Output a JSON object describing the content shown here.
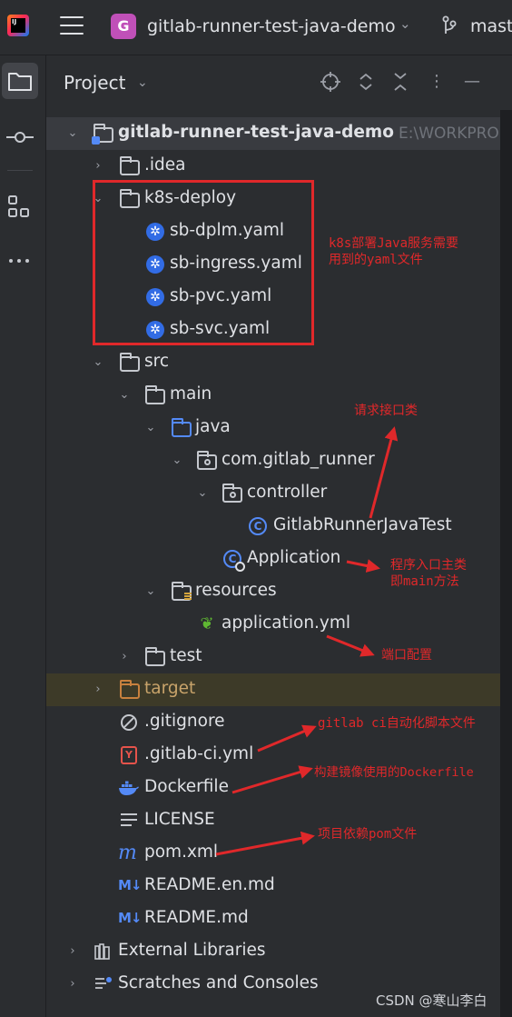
{
  "header": {
    "app_logo_text": "IJ",
    "project_badge": "G",
    "project_name": "gitlab-runner-test-java-demo",
    "branch_name": "mast"
  },
  "panel": {
    "title": "Project"
  },
  "tree": {
    "root": {
      "name": "gitlab-runner-test-java-demo",
      "path": "E:\\WORKPRO"
    },
    "idea": ".idea",
    "k8s_deploy": "k8s-deploy",
    "k8s_files": [
      "sb-dplm.yaml",
      "sb-ingress.yaml",
      "sb-pvc.yaml",
      "sb-svc.yaml"
    ],
    "src": "src",
    "main": "main",
    "java": "java",
    "package": "com.gitlab_runner",
    "controller": "controller",
    "controller_class": "GitlabRunnerJavaTest",
    "application_class": "Application",
    "resources": "resources",
    "application_yml": "application.yml",
    "test": "test",
    "target": "target",
    "gitignore": ".gitignore",
    "gitlab_ci": ".gitlab-ci.yml",
    "dockerfile": "Dockerfile",
    "license": "LICENSE",
    "pom": "pom.xml",
    "readme_en": "README.en.md",
    "readme": "README.md",
    "external_libraries": "External Libraries",
    "scratches": "Scratches and Consoles"
  },
  "annotations": {
    "k8s_line1": "k8s部署Java服务需要",
    "k8s_line2": "用到的yaml文件",
    "controller": "请求接口类",
    "app_line1": "程序入口主类",
    "app_line2": "即main方法",
    "port": "端口配置",
    "gitlab_ci": "gitlab ci自动化脚本文件",
    "dockerfile": "构建镜像使用的Dockerfile",
    "pom": "项目依赖pom文件"
  },
  "watermark": "CSDN @寒山李白",
  "colors": {
    "annotation_red": "#e0282a",
    "accent_blue": "#548af7",
    "k8s_blue": "#326ce5",
    "project_badge": "#c050b8"
  }
}
